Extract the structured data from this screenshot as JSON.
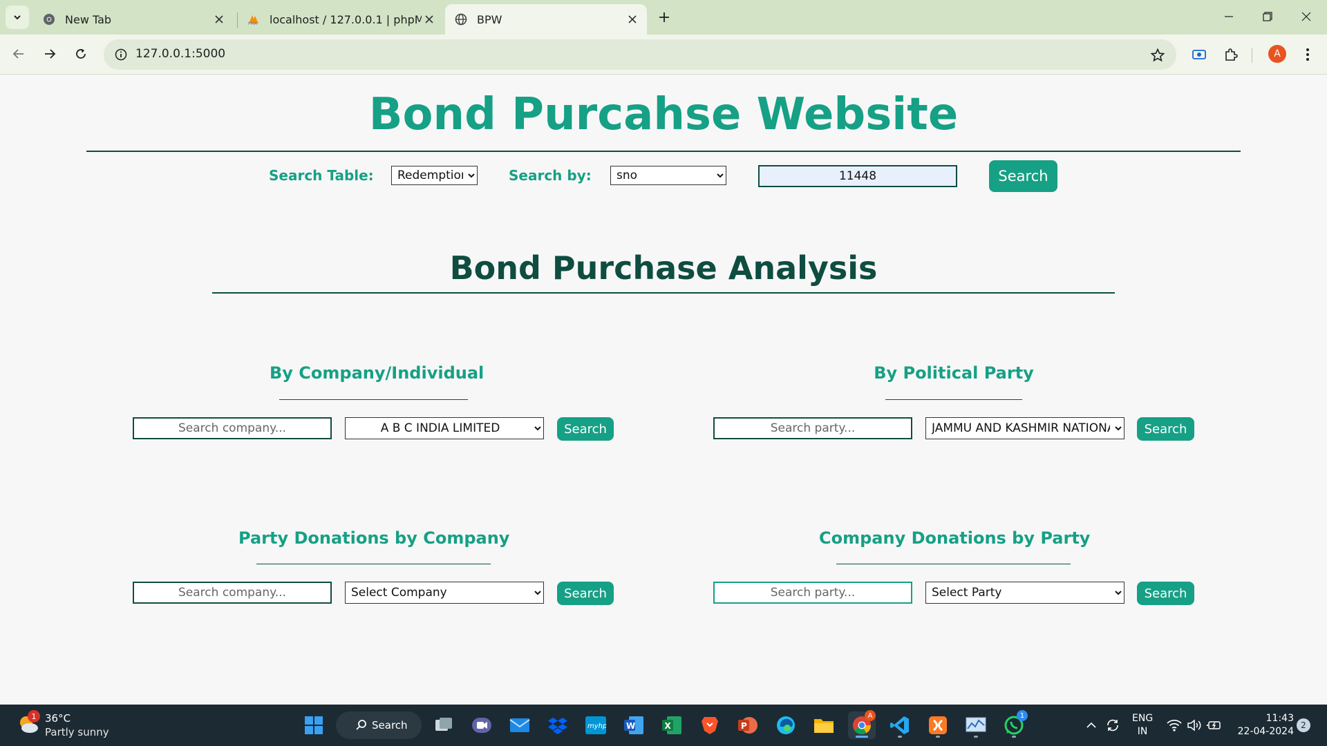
{
  "browser": {
    "tabs": [
      {
        "title": "New Tab",
        "favicon": "chrome-icon",
        "active": false
      },
      {
        "title": "localhost / 127.0.0.1 | phpMyAdmin",
        "favicon": "phpmyadmin-icon",
        "active": false
      },
      {
        "title": "BPW",
        "favicon": "globe-icon",
        "active": true
      }
    ],
    "url": "127.0.0.1:5000",
    "profile_initial": "A"
  },
  "page": {
    "site_title": "Bond Purcahse Website",
    "search_table_label": "Search Table:",
    "search_table_value": "Redemption",
    "search_by_label": "Search by:",
    "search_by_value": "sno",
    "search_value": "11448",
    "search_button": "Search",
    "analysis_title": "Bond Purchase Analysis",
    "sections": {
      "company": {
        "title": "By Company/Individual",
        "placeholder": "Search company...",
        "selected": "A B C INDIA LIMITED",
        "button": "Search"
      },
      "party": {
        "title": "By Political Party",
        "placeholder": "Search party...",
        "selected": "JAMMU AND KASHMIR NATIONAL CONFERENCE",
        "button": "Search"
      },
      "party_donations": {
        "title": "Party Donations by Company",
        "placeholder": "Search company...",
        "selected": "Select Company",
        "button": "Search"
      },
      "company_donations": {
        "title": "Company Donations by Party",
        "placeholder": "Search party...",
        "selected": "Select Party",
        "button": "Search"
      }
    },
    "colors": {
      "accent": "#16a085",
      "dark": "#0e4d40"
    }
  },
  "taskbar": {
    "weather_temp": "36°C",
    "weather_desc": "Partly sunny",
    "weather_badge": "1",
    "search_label": "Search",
    "language_line1": "ENG",
    "language_line2": "IN",
    "time": "11:43",
    "date": "22-04-2024",
    "notification_count": "2",
    "whatsapp_badge": "1",
    "chrome_badge": "A"
  }
}
